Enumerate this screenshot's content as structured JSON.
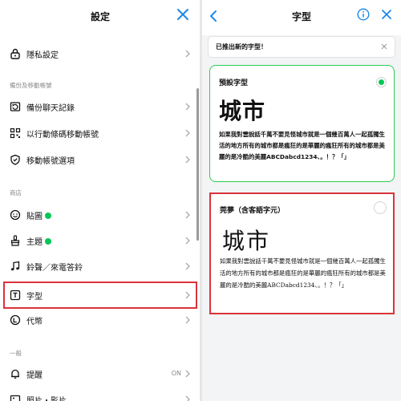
{
  "left_panel": {
    "title": "設定",
    "items_privacy": {
      "label": "隱私設定"
    },
    "section_backup": "備份及移動帳號",
    "backup_items": [
      {
        "label": "備份聊天記錄",
        "icon": "backup-chat-icon"
      },
      {
        "label": "以行動條碼移動帳號",
        "icon": "qr-code-icon"
      },
      {
        "label": "移動帳號選項",
        "icon": "shield-icon"
      }
    ],
    "section_store": "商店",
    "store_items": [
      {
        "label": "貼圖",
        "icon": "smile-icon",
        "badge": true
      },
      {
        "label": "主題",
        "icon": "brush-icon",
        "badge": true
      },
      {
        "label": "鈴聲／來電答鈴",
        "icon": "music-note-icon"
      },
      {
        "label": "字型",
        "icon": "font-icon"
      },
      {
        "label": "代幣",
        "icon": "coin-icon"
      }
    ],
    "section_general": "一般",
    "general_items": [
      {
        "label": "提醒",
        "value": "ON",
        "icon": "bell-icon"
      },
      {
        "label": "照片・影片",
        "icon": "photo-icon"
      }
    ]
  },
  "right_panel": {
    "title": "字型",
    "banner": "已推出新的字型！",
    "fonts": [
      {
        "name": "預設字型",
        "selected": true,
        "preview": "城市",
        "sample": "如果我對雲說話千萬不要見怪城市就是一個幾百萬人一起孤獨生活的地方所有的城市都是瘋狂的是華麗的瘋狂所有的城市都是美麗的是冷酷的美麗ABCDabcd1234、。！？「」"
      },
      {
        "name": "莞夢（含客語字元）",
        "selected": false,
        "preview": "城市",
        "sample": "如果我對雲說話千萬不要見怪城市就是一個幾百萬人一起孤獨生活的地方所有的城市都是瘋狂的是華麗的瘋狂所有的城市都是美麗的是冷酷的美麗ABCDabcd1234、。！？「」"
      }
    ]
  },
  "colors": {
    "accent_green": "#06c755",
    "link_blue": "#1e88e5",
    "highlight_red": "#d9343a"
  }
}
